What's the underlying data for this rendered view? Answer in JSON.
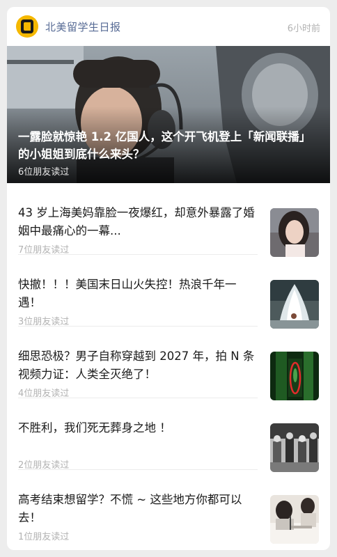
{
  "header": {
    "account_name": "北美留学生日报",
    "time": "6小时前",
    "logo_icon": "publisher-logo-icon"
  },
  "hero": {
    "title": "一露脸就惊艳 1.2 亿国人，这个开飞机登上「新闻联播」的小姐姐到底什么来头？",
    "meta": "6位朋友读过"
  },
  "articles": [
    {
      "title": "43 岁上海美妈靠脸一夜爆红，却意外暴露了婚姻中最痛心的一幕...",
      "meta": "7位朋友读过"
    },
    {
      "title": "快撤！！！美国末日山火失控！热浪千年一遇！",
      "meta": "3位朋友读过"
    },
    {
      "title": "细思恐极？男子自称穿越到 2027 年，拍 N 条视频力证：人类全灭绝了！",
      "meta": "4位朋友读过"
    },
    {
      "title": "不胜利，我们死无葬身之地 ！",
      "meta": "2位朋友读过"
    },
    {
      "title": "高考结束想留学？不慌 ~ 这些地方你都可以去！",
      "meta": "1位朋友读过"
    }
  ],
  "colors": {
    "account_name": "#576b95",
    "meta_text": "#b2b2b2",
    "logo": "#f5b800"
  }
}
